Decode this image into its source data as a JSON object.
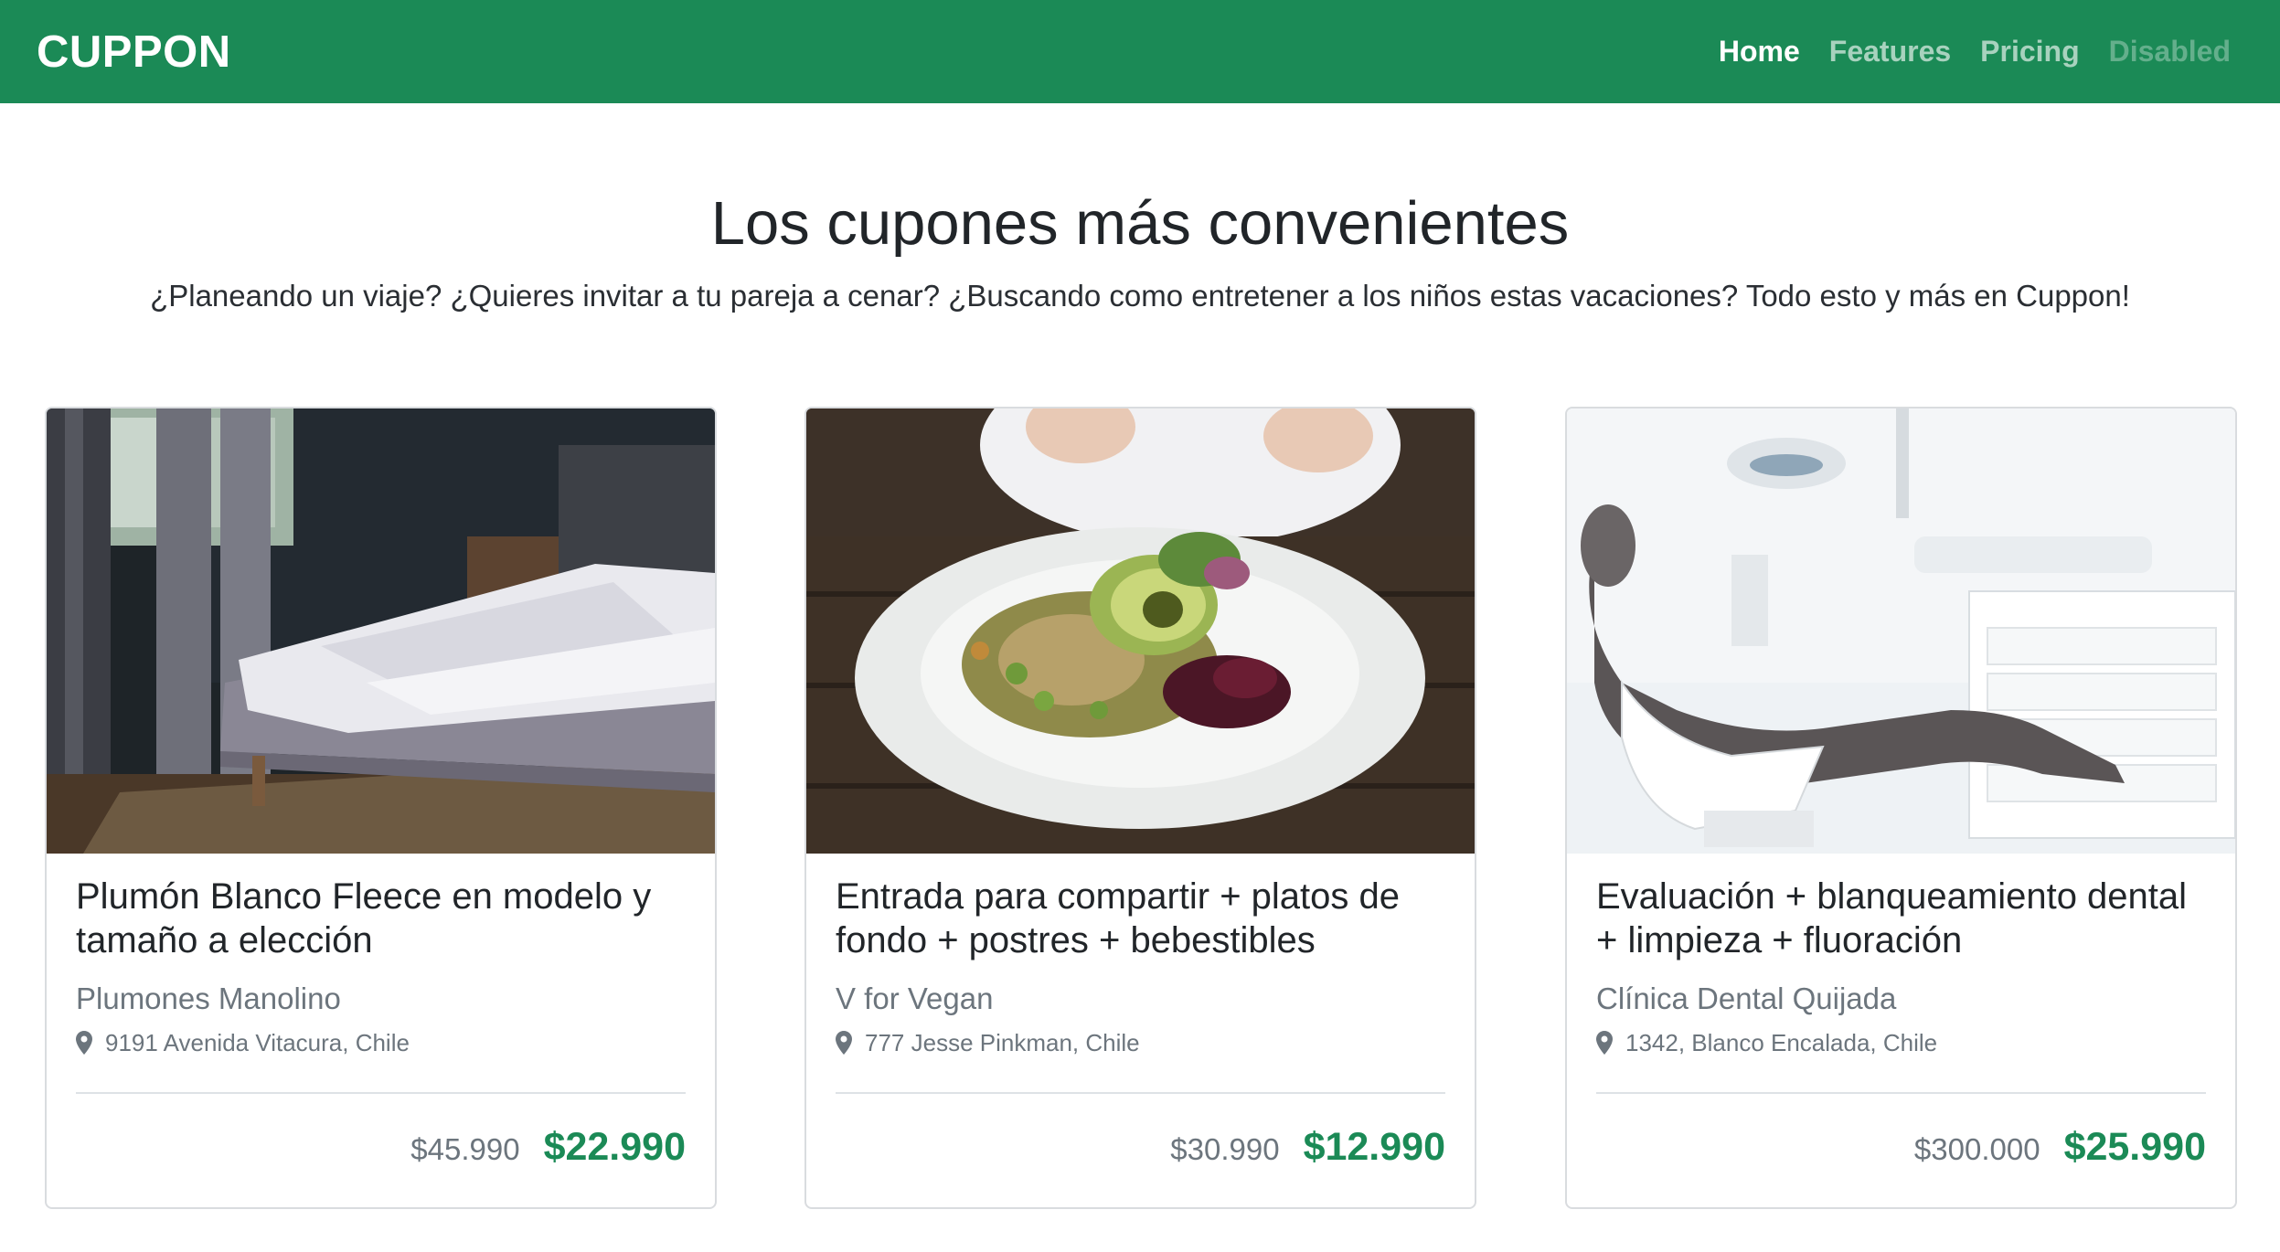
{
  "brand": "CUPPON",
  "nav": {
    "home": "Home",
    "features": "Features",
    "pricing": "Pricing",
    "disabled": "Disabled"
  },
  "hero": {
    "title": "Los cupones más convenientes",
    "subtitle": "¿Planeando un viaje? ¿Quieres invitar a tu pareja a cenar? ¿Buscando como entretener a los niños estas vacaciones? Todo esto y más en Cuppon!"
  },
  "cards": [
    {
      "title": "Plumón Blanco Fleece en modelo y tamaño a elección",
      "vendor": "Plumones Manolino",
      "location": "9191 Avenida Vitacura, Chile",
      "old_price": "$45.990",
      "new_price": "$22.990",
      "image": "bedroom-photo"
    },
    {
      "title": "Entrada para compartir + platos de fondo + postres + bebestibles",
      "vendor": "V for Vegan",
      "location": "777 Jesse Pinkman, Chile",
      "old_price": "$30.990",
      "new_price": "$12.990",
      "image": "salad-plate-photo"
    },
    {
      "title": "Evaluación + blanqueamiento dental + limpieza + fluoración",
      "vendor": "Clínica Dental Quijada",
      "location": "1342, Blanco Encalada, Chile",
      "old_price": "$300.000",
      "new_price": "$25.990",
      "image": "dental-chair-photo"
    }
  ],
  "colors": {
    "brand_green": "#1b8a56",
    "muted_text": "#6c757d"
  },
  "icons": {
    "location": "map-pin-icon"
  }
}
